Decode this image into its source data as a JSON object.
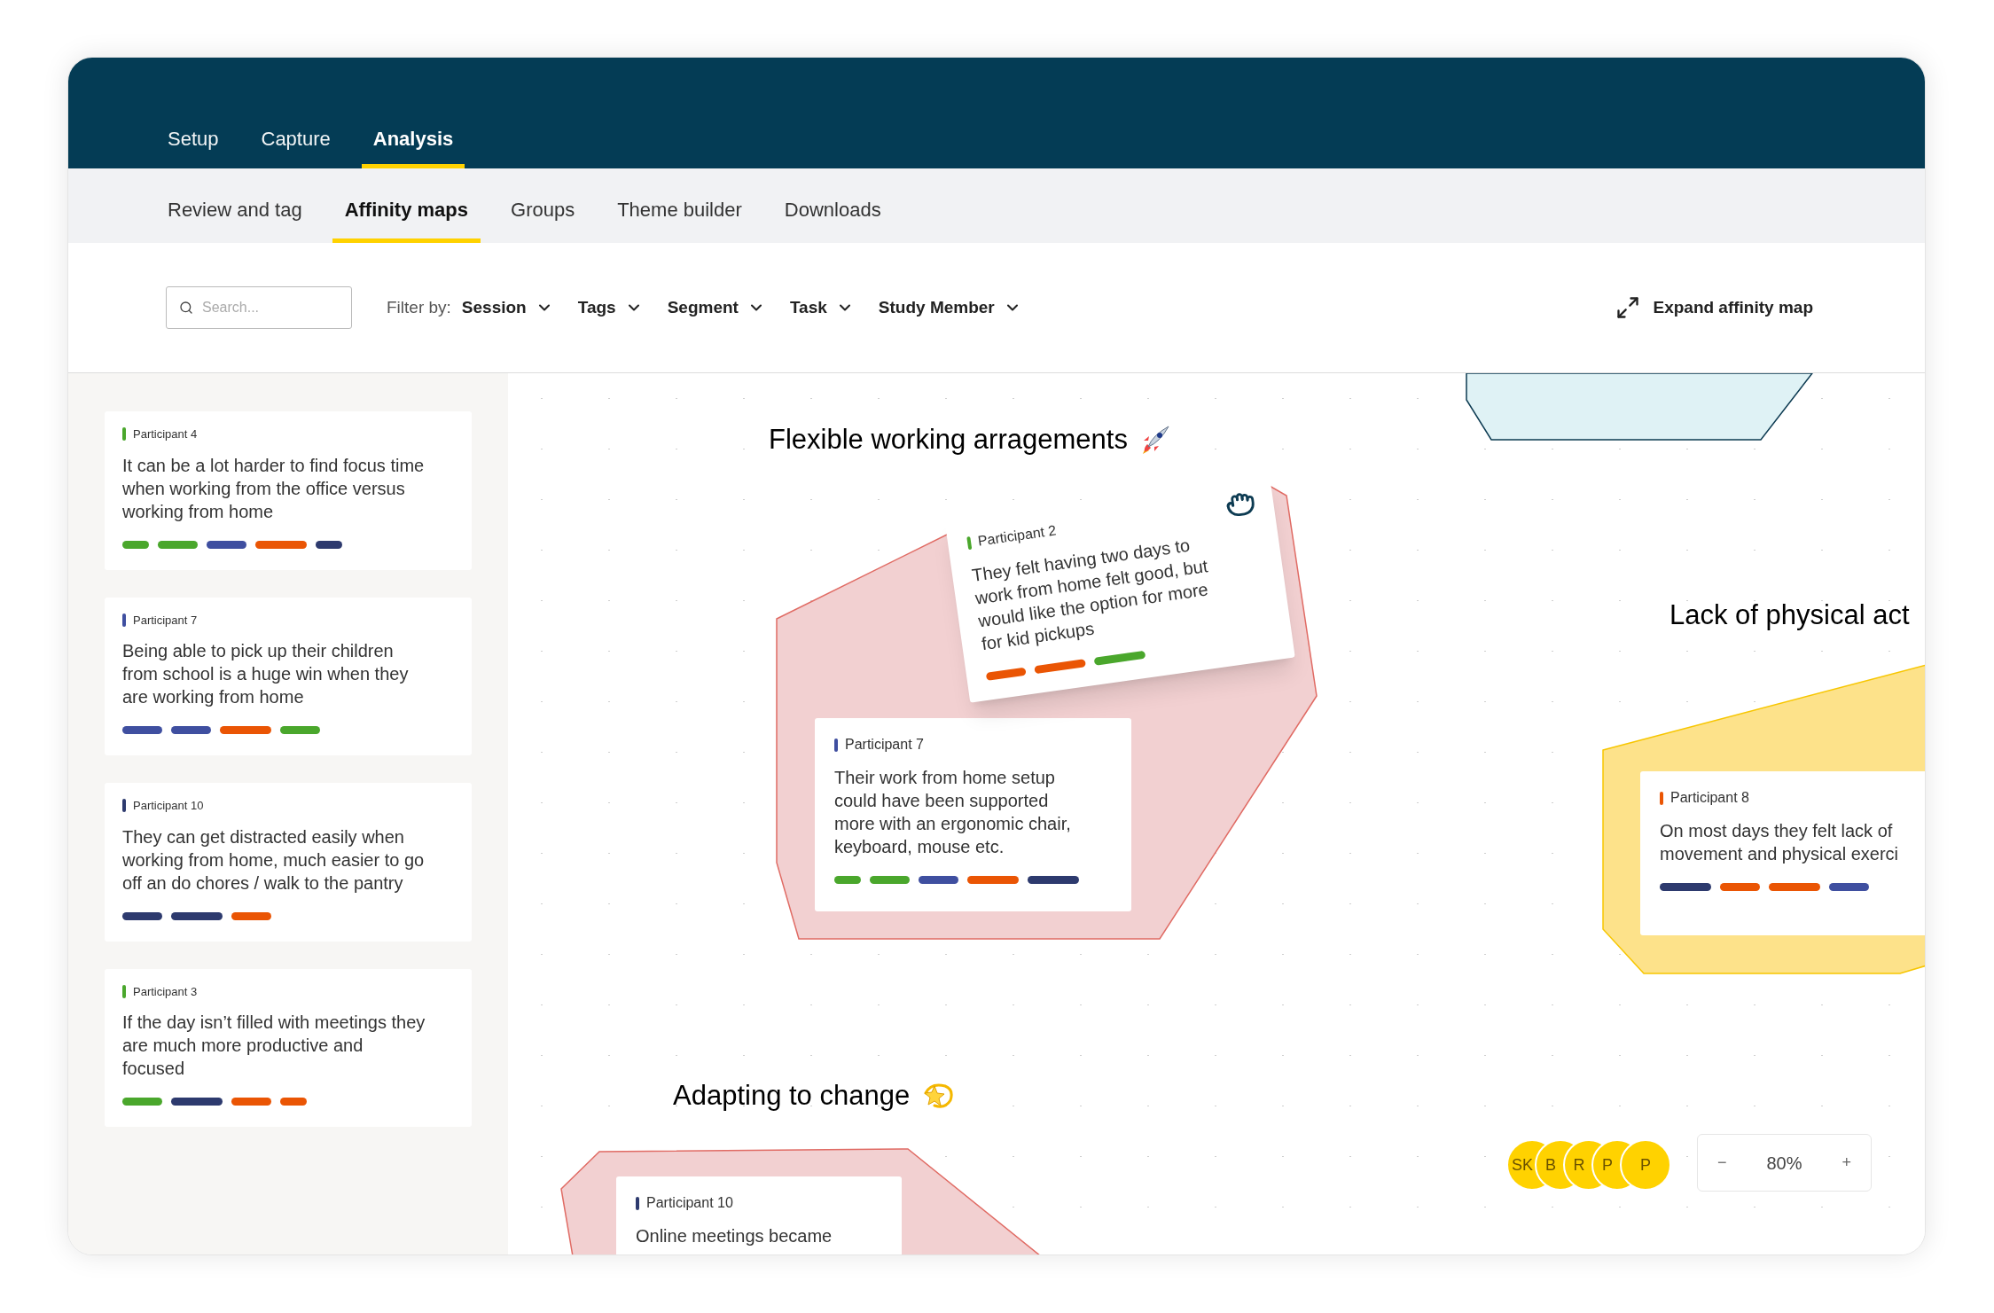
{
  "top_tabs": [
    {
      "label": "Setup",
      "selected": false
    },
    {
      "label": "Capture",
      "selected": false
    },
    {
      "label": "Analysis",
      "selected": true
    }
  ],
  "sub_tabs": [
    {
      "label": "Review and tag",
      "selected": false
    },
    {
      "label": "Affinity maps",
      "selected": true
    },
    {
      "label": "Groups",
      "selected": false
    },
    {
      "label": "Theme builder",
      "selected": false
    },
    {
      "label": "Downloads",
      "selected": false
    }
  ],
  "filter_bar": {
    "search": {
      "placeholder": "Search..."
    },
    "filter_label": "Filter by:",
    "filters": [
      "Session",
      "Tags",
      "Segment",
      "Task",
      "Study Member"
    ],
    "expand": "Expand affinity map"
  },
  "sidebar": {
    "cards": [
      {
        "participant": "Participant 4",
        "color": "#4aa72c",
        "lines": [
          "It can be a lot harder to find focus time when working from the office versus working from home"
        ],
        "tags": [
          {
            "color": "#4aa72c",
            "kind": "s"
          },
          {
            "color": "#4aa72c",
            "kind": "m"
          },
          {
            "color": "#3f4fa0",
            "kind": "m"
          },
          {
            "color": "#ea5504",
            "kind": "l"
          },
          {
            "color": "#2d3a6e",
            "kind": "s"
          }
        ]
      },
      {
        "participant": "Participant 7",
        "color": "#3f4fa0",
        "lines": [
          "Being able to pick up their children from school is a huge win when they are working from home"
        ],
        "tags": [
          {
            "color": "#3f4fa0",
            "kind": "m"
          },
          {
            "color": "#3f4fa0",
            "kind": "m"
          },
          {
            "color": "#ea5504",
            "kind": "l"
          },
          {
            "color": "#4aa72c",
            "kind": "m"
          }
        ]
      },
      {
        "participant": "Participant 10",
        "color": "#2d3a6e",
        "lines": [
          "They can get distracted easily when working from home, much easier to go off an do chores / walk to the pantry"
        ],
        "tags": [
          {
            "color": "#2d3a6e",
            "kind": "m"
          },
          {
            "color": "#2d3a6e",
            "kind": "l"
          },
          {
            "color": "#ea5504",
            "kind": "m"
          }
        ]
      },
      {
        "participant": "Participant 3",
        "color": "#4aa72c",
        "lines": [
          "If the day isn’t filled with meetings they are much more productive and focused"
        ],
        "tags": [
          {
            "color": "#4aa72c",
            "kind": "m"
          },
          {
            "color": "#2d3a6e",
            "kind": "l"
          },
          {
            "color": "#ea5504",
            "kind": "m"
          },
          {
            "color": "#ea5504",
            "kind": "s"
          }
        ]
      }
    ]
  },
  "canvas": {
    "groups": [
      {
        "color": "#dff2f5"
      },
      {
        "title": "Flexible working arragements",
        "color": "#f2d0d1",
        "cards": [
          {
            "participant": "Participant 2",
            "color": "#4aa72c",
            "dragging": true,
            "lines": [
              "They felt having two days to work from home felt good, but would like the option for more for kid pickups"
            ],
            "tags": [
              {
                "color": "#ea5504",
                "kind": "m"
              },
              {
                "color": "#ea5504",
                "kind": "l"
              },
              {
                "color": "#4aa72c",
                "kind": "l"
              }
            ]
          },
          {
            "participant": "Participant 7",
            "color": "#3f4fa0",
            "dragging": false,
            "lines": [
              "Their work from home setup could have been supported more with an ergonomic chair, keyboard, mouse etc."
            ],
            "tags": [
              {
                "color": "#4aa72c",
                "kind": "s"
              },
              {
                "color": "#4aa72c",
                "kind": "m"
              },
              {
                "color": "#3f4fa0",
                "kind": "m"
              },
              {
                "color": "#ea5504",
                "kind": "l"
              },
              {
                "color": "#2d3a6e",
                "kind": "l"
              }
            ]
          }
        ]
      },
      {
        "title": "Lack of physical act",
        "color": "#fde28a",
        "cards": [
          {
            "participant": "Participant 8",
            "color": "#ea5504",
            "dragging": false,
            "lines": [
              "On most days they felt lack of",
              "movement and physical exerci"
            ],
            "tags": [
              {
                "color": "#2d3a6e",
                "kind": "l"
              },
              {
                "color": "#ea5504",
                "kind": "m"
              },
              {
                "color": "#ea5504",
                "kind": "l"
              },
              {
                "color": "#3f4fa0",
                "kind": "m"
              }
            ]
          }
        ]
      },
      {
        "title": "Adapting to change",
        "color": "#f2d0d1",
        "cards": [
          {
            "participant": "Participant 10",
            "color": "#2d3a6e",
            "dragging": false,
            "lines": [
              "Online meetings became"
            ]
          }
        ]
      }
    ],
    "collaborators": [
      "SK",
      "B",
      "R",
      "P",
      "P"
    ],
    "zoom": {
      "minus": "−",
      "value": "80%",
      "plus": "+"
    }
  }
}
